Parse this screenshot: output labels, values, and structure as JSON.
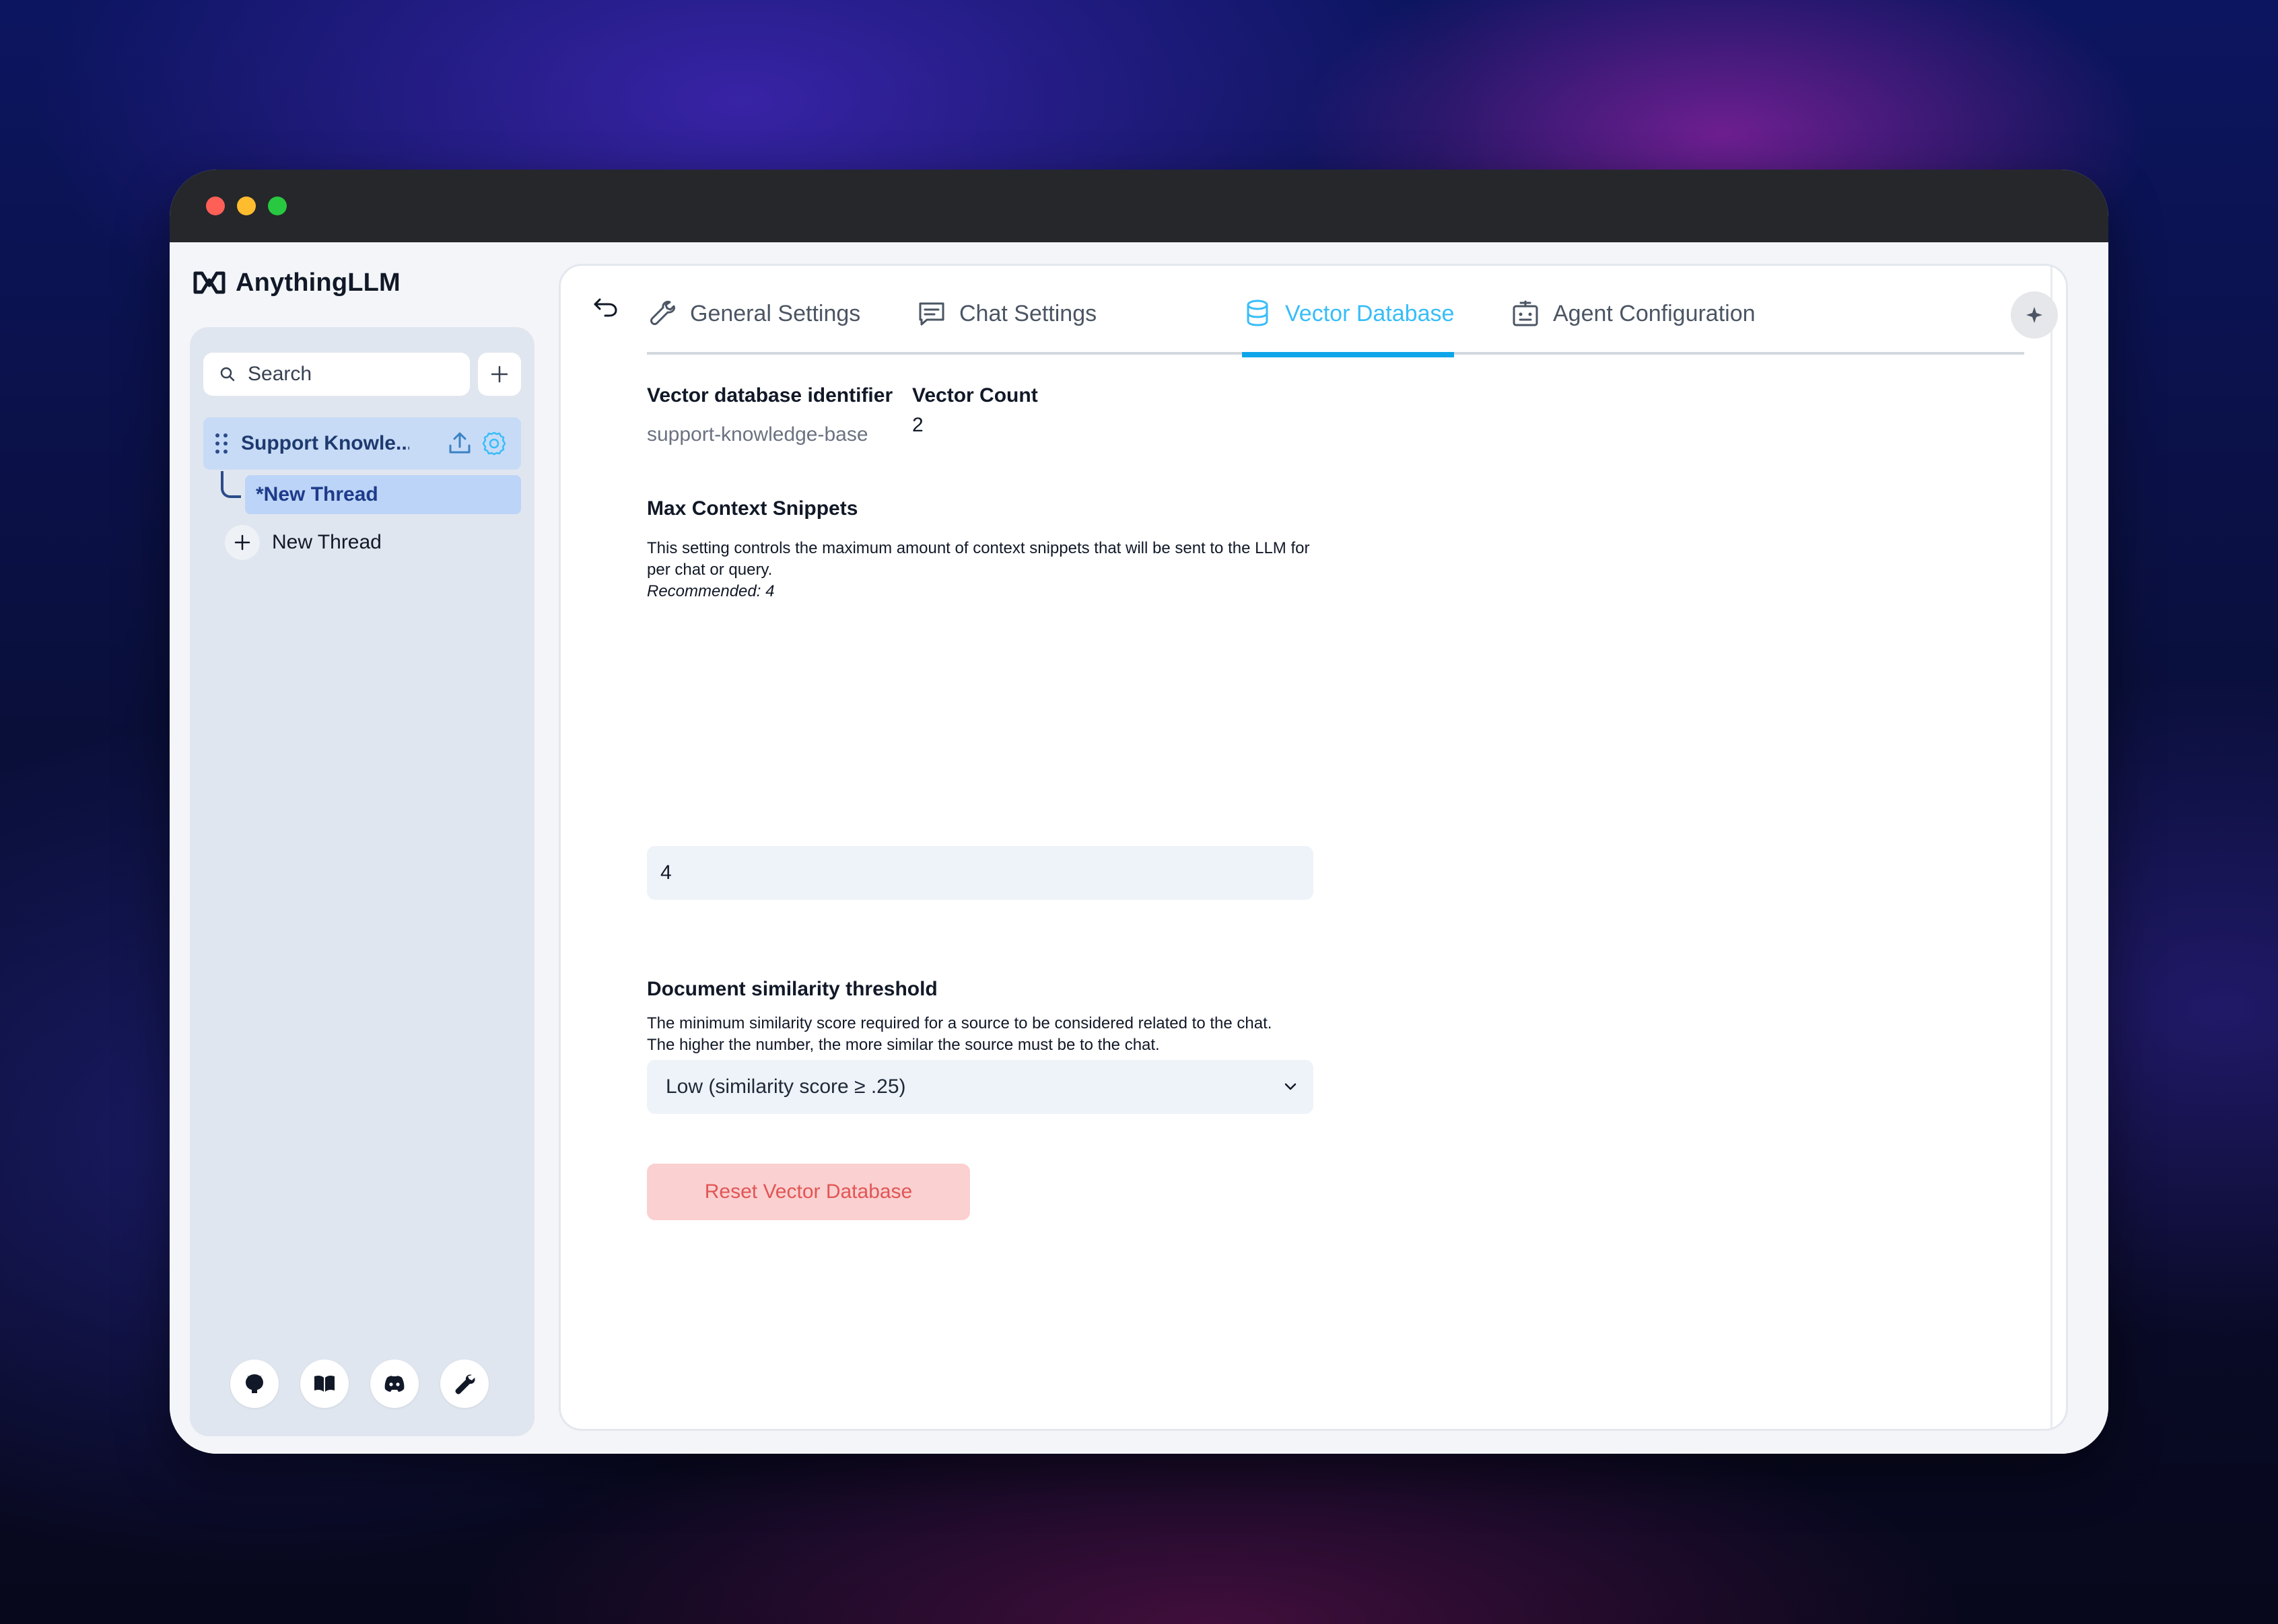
{
  "window": {
    "traffic_lights": [
      "close",
      "minimize",
      "maximize"
    ]
  },
  "brand": {
    "name": "AnythingLLM"
  },
  "sidebar": {
    "search_placeholder": "Search",
    "workspace": {
      "name": "Support Knowle..."
    },
    "thread": {
      "label": "*New Thread"
    },
    "new_thread_label": "New Thread",
    "footer_icons": [
      "github-icon",
      "docs-book-icon",
      "discord-icon",
      "settings-wrench-icon"
    ]
  },
  "tabs": [
    {
      "label": "General Settings",
      "icon": "wrench-icon",
      "active": false
    },
    {
      "label": "Chat Settings",
      "icon": "chat-icon",
      "active": false
    },
    {
      "label": "Vector Database",
      "icon": "database-icon",
      "active": true
    },
    {
      "label": "Agent Configuration",
      "icon": "robot-icon",
      "active": false
    }
  ],
  "vector_settings": {
    "identifier_label": "Vector database identifier",
    "identifier_value": "support-knowledge-base",
    "count_label": "Vector Count",
    "count_value": "2",
    "max_snippets": {
      "label": "Max Context Snippets",
      "description": "This setting controls the maximum amount of context snippets that will be sent to the LLM for per chat or query.",
      "recommended": "Recommended: 4",
      "value": "4"
    },
    "similarity": {
      "label": "Document similarity threshold",
      "description_line1": "The minimum similarity score required for a source to be considered related to the chat.",
      "description_line2": "The higher the number, the more similar the source must be to the chat.",
      "selected": "Low (similarity score ≥ .25)"
    },
    "reset_button": "Reset Vector Database"
  },
  "colors": {
    "accent": "#38bdf8",
    "sidebar_bg": "#e0e6ef",
    "workspace_highlight": "#c7dbf7",
    "danger_bg": "#fbd0d0",
    "danger_text": "#e25555"
  }
}
